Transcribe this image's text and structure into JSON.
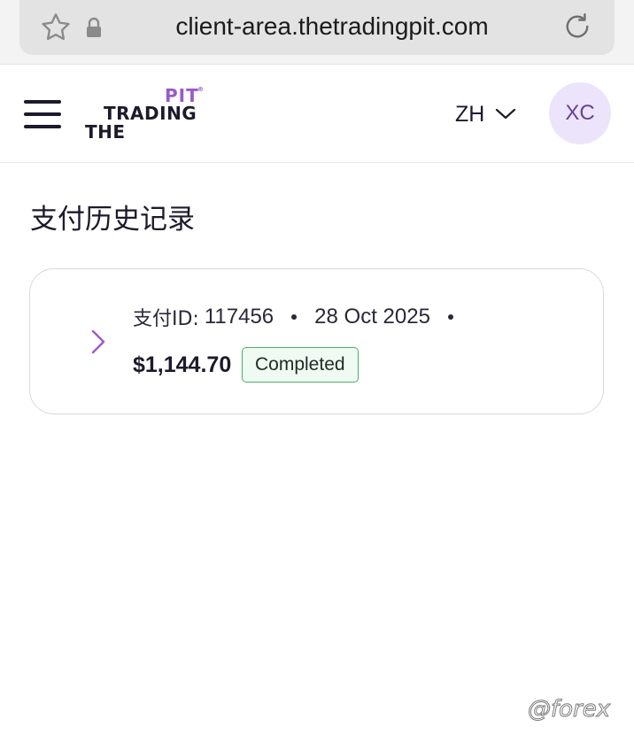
{
  "browser": {
    "url": "client-area.thetradingpit.com",
    "bookmark_icon": "star-icon",
    "secure_icon": "lock-icon",
    "reload_icon": "reload-icon"
  },
  "header": {
    "menu_icon": "hamburger-menu-icon",
    "logo": {
      "line1": "PIT",
      "registered": "®",
      "line2": "TRADING",
      "line3": "THE"
    },
    "language": "ZH",
    "avatar_initials": "XC"
  },
  "page": {
    "title": "支付历史记录"
  },
  "payments": [
    {
      "id_label": "支付ID:",
      "id_value": "117456",
      "date": "28 Oct 2025",
      "amount": "$1,144.70",
      "status": "Completed"
    }
  ],
  "watermark": "@forex",
  "colors": {
    "brand_purple": "#9b59c9",
    "brand_dark": "#1c1a2b",
    "avatar_bg": "#ece4fb",
    "status_border": "#48b06a",
    "status_bg": "#effbf2"
  }
}
